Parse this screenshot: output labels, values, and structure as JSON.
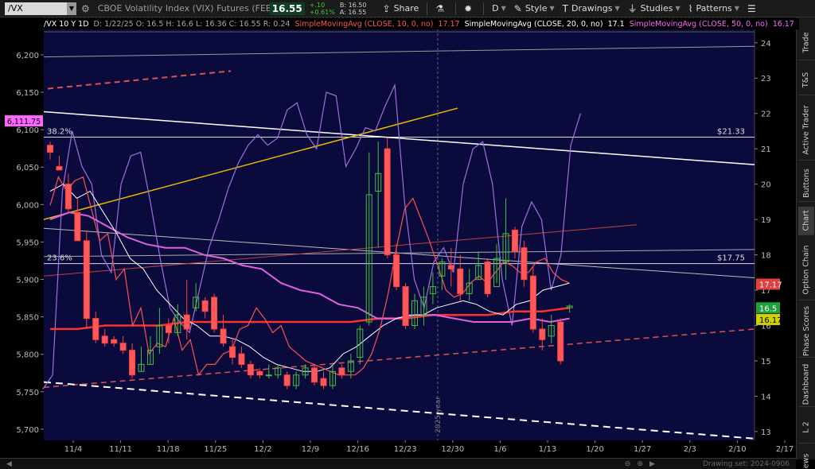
{
  "toolbar": {
    "symbol": "/VX",
    "description": "CBOE Volatility Index (VIX) Futures (FEB 25)",
    "last": "16.55",
    "change": "+.10",
    "change_pct": "+0.61%",
    "bid": "B: 16.50",
    "ask": "A: 16.55",
    "share": "Share",
    "period": "D",
    "style": "Style",
    "drawings": "Drawings",
    "studies": "Studies",
    "patterns": "Patterns"
  },
  "study_header": {
    "chart_label": "/VX 10 Y 1D",
    "ohlc": "D: 1/22/25  O: 16.5  H: 16.6  L: 16.36  C: 16.55  R: 0.24",
    "sma10": "SimpleMovingAvg (CLOSE, 10, 0, no)",
    "sma10_val": "17.17",
    "sma20": "SimpleMovingAvg (CLOSE, 20, 0, no)",
    "sma20_val": "17.1",
    "sma50": "SimpleMovingAvg (CLOSE, 50, 0, no)",
    "sma50_val": "16.17"
  },
  "chart_data": {
    "type": "candlestick",
    "left_axis": {
      "ticks": [
        "6,200",
        "6,150",
        "6,100",
        "6,050",
        "6,000",
        "5,950",
        "5,900",
        "5,850",
        "5,800",
        "5,750",
        "5,700"
      ],
      "values": [
        6200,
        6150,
        6100,
        6050,
        6000,
        5950,
        5900,
        5850,
        5800,
        5750,
        5700
      ],
      "range": [
        5685,
        6235
      ],
      "marker": "6,111.75",
      "marker_value": 6111.75
    },
    "right_axis": {
      "ticks": [
        "24",
        "23",
        "22",
        "21",
        "20",
        "19",
        "18",
        "17",
        "16",
        "15",
        "14",
        "13"
      ],
      "values": [
        24,
        23,
        22,
        21,
        20,
        19,
        18,
        17,
        16,
        15,
        14,
        13
      ],
      "range": [
        12.75,
        24.4
      ]
    },
    "x_axis": {
      "labels": [
        "11/4",
        "11/11",
        "11/18",
        "11/25",
        "12/2",
        "12/9",
        "12/16",
        "12/23",
        "12/30",
        "1/6",
        "1/13",
        "1/20",
        "1/27",
        "2/3",
        "2/10",
        "2/17"
      ]
    },
    "year_marker": "2025 year",
    "fib_levels": [
      {
        "label": "38.2%",
        "price": "$21.33",
        "value": 21.33
      },
      {
        "label": "23.6%",
        "price": "$17.75",
        "value": 17.75
      }
    ],
    "sma200": [
      [
        15.9,
        15.9
      ],
      [
        16.0,
        16.0
      ],
      [
        16.0,
        16.1
      ],
      [
        16.1,
        16.1
      ],
      [
        16.1,
        16.1
      ],
      [
        16.1,
        16.1
      ],
      [
        16.2,
        16.2
      ],
      [
        16.3,
        16.3
      ],
      [
        16.3,
        16.4
      ],
      [
        16.4,
        16.5
      ]
    ],
    "price_badges": [
      {
        "label": "17.17",
        "value": 17.17,
        "color": "#e04040"
      },
      {
        "label": "16.5",
        "value": 16.5,
        "color": "#20a040"
      },
      {
        "label": "16.17",
        "value": 16.17,
        "color": "#d0d000"
      }
    ],
    "candles": [
      [
        21.1,
        21.1,
        20.9,
        21.2,
        20.7
      ],
      [
        20.5,
        20.7,
        20.4,
        20.8,
        20.4
      ],
      [
        20.0,
        20.2,
        19.3,
        20.3,
        19.2
      ],
      [
        19.2,
        19.5,
        18.4,
        19.6,
        18.4
      ],
      [
        18.4,
        18.5,
        16.2,
        18.7,
        15.9
      ],
      [
        16.2,
        16.3,
        15.6,
        16.4,
        15.5
      ],
      [
        15.7,
        15.8,
        15.5,
        15.9,
        15.4
      ],
      [
        15.6,
        15.6,
        15.5,
        15.7,
        15.4
      ],
      [
        15.5,
        15.6,
        15.3,
        15.7,
        15.2
      ],
      [
        15.3,
        15.5,
        14.6,
        15.5,
        14.5
      ],
      [
        14.7,
        14.9,
        14.9,
        15.4,
        14.7
      ],
      [
        14.9,
        15.5,
        15.3,
        15.7,
        14.9
      ],
      [
        15.4,
        16.1,
        16.0,
        16.5,
        15.2
      ],
      [
        16.0,
        16.0,
        15.8,
        16.2,
        15.5
      ],
      [
        15.8,
        16.4,
        16.3,
        16.6,
        15.7
      ],
      [
        16.3,
        16.3,
        15.9,
        17.3,
        15.6
      ],
      [
        16.5,
        16.9,
        16.8,
        17.2,
        16.4
      ],
      [
        16.7,
        16.7,
        16.4,
        16.8,
        16.2
      ],
      [
        16.8,
        16.8,
        15.9,
        16.9,
        15.8
      ],
      [
        15.9,
        16.0,
        15.5,
        16.3,
        15.4
      ],
      [
        15.4,
        15.5,
        15.1,
        15.6,
        14.9
      ],
      [
        15.2,
        15.2,
        14.9,
        15.4,
        14.8
      ],
      [
        14.9,
        14.9,
        14.6,
        15.0,
        14.5
      ],
      [
        14.7,
        14.7,
        14.6,
        14.8,
        14.5
      ],
      [
        14.6,
        14.7,
        14.6,
        14.9,
        14.5
      ],
      [
        14.6,
        14.9,
        14.8,
        14.9,
        14.5
      ],
      [
        14.6,
        14.6,
        14.3,
        14.7,
        14.2
      ],
      [
        14.3,
        14.6,
        14.6,
        14.7,
        14.2
      ],
      [
        14.6,
        14.8,
        14.8,
        14.9,
        14.5
      ],
      [
        14.8,
        14.8,
        14.4,
        14.9,
        14.3
      ],
      [
        14.5,
        14.5,
        14.3,
        14.7,
        14.2
      ],
      [
        14.3,
        14.8,
        14.7,
        14.9,
        14.2
      ],
      [
        14.8,
        14.8,
        14.6,
        14.9,
        14.5
      ],
      [
        14.7,
        15.0,
        15.0,
        15.2,
        14.5
      ],
      [
        15.1,
        16.0,
        15.9,
        16.0,
        14.9
      ],
      [
        16.1,
        19.9,
        19.7,
        20.9,
        16.0
      ],
      [
        19.8,
        21.0,
        20.3,
        21.2,
        18.2
      ],
      [
        21.0,
        21.1,
        18.0,
        21.3,
        17.9
      ],
      [
        18.0,
        18.0,
        17.1,
        18.3,
        17.0
      ],
      [
        17.1,
        17.1,
        16.0,
        17.2,
        15.9
      ],
      [
        16.0,
        16.7,
        16.7,
        16.9,
        15.9
      ],
      [
        16.3,
        16.8,
        16.8,
        17.1,
        16.0
      ],
      [
        16.9,
        17.2,
        17.1,
        17.5,
        16.6
      ],
      [
        17.4,
        17.9,
        17.8,
        17.9,
        17.0
      ],
      [
        17.7,
        17.7,
        17.6,
        18.2,
        17.1
      ],
      [
        17.6,
        17.7,
        16.9,
        18.0,
        16.7
      ],
      [
        16.9,
        17.4,
        17.2,
        17.6,
        16.7
      ],
      [
        17.3,
        17.8,
        17.7,
        18.1,
        17.3
      ],
      [
        17.8,
        17.8,
        16.9,
        17.9,
        16.8
      ],
      [
        17.1,
        18.0,
        17.9,
        18.3,
        17.2
      ],
      [
        17.8,
        18.7,
        18.6,
        19.6,
        17.3
      ],
      [
        18.7,
        18.7,
        18.1,
        18.8,
        17.9
      ],
      [
        18.2,
        18.2,
        17.3,
        18.4,
        17.1
      ],
      [
        17.4,
        17.6,
        15.9,
        17.7,
        15.8
      ],
      [
        15.9,
        16.1,
        15.6,
        16.2,
        15.3
      ],
      [
        15.7,
        16.1,
        16.0,
        16.3,
        15.5
      ],
      [
        16.1,
        16.1,
        15.0,
        16.2,
        14.9
      ],
      [
        16.5,
        16.6,
        16.55,
        16.6,
        16.36
      ]
    ],
    "sma10": [
      [
        19.4,
        20.2
      ],
      [
        19.8,
        20.1
      ],
      [
        20.2,
        19.3
      ],
      [
        18.4,
        18.6
      ],
      [
        17.3,
        17.6
      ],
      [
        16.0,
        16.5
      ],
      [
        15.2,
        15.5
      ],
      [
        15.4,
        16.2
      ],
      [
        15.3,
        15.6
      ],
      [
        14.6,
        14.9
      ],
      [
        14.9,
        15.2
      ],
      [
        15.3,
        15.9
      ],
      [
        16.0,
        16.5
      ],
      [
        16.2,
        15.8
      ],
      [
        16.0,
        15.4
      ],
      [
        15.2,
        15.0
      ],
      [
        14.9,
        14.8
      ],
      [
        14.7,
        14.6
      ],
      [
        14.6,
        14.6
      ],
      [
        14.8,
        15.2
      ],
      [
        15.9,
        16.9
      ],
      [
        18.2,
        19.3
      ],
      [
        19.6,
        19.0
      ],
      [
        18.4,
        17.7
      ],
      [
        17.0,
        16.8
      ],
      [
        16.9,
        17.2
      ],
      [
        17.4,
        17.2
      ],
      [
        17.5,
        17.8
      ],
      [
        17.7,
        17.5
      ],
      [
        17.5,
        17.8
      ],
      [
        17.9,
        17.5
      ],
      [
        17.3,
        17.2
      ]
    ],
    "sma20": [
      [
        19.8,
        20.0
      ],
      [
        19.6,
        19.8
      ],
      [
        19.2,
        18.6
      ],
      [
        17.9,
        17.6
      ],
      [
        17.0,
        16.6
      ],
      [
        16.2,
        16.0
      ],
      [
        15.7,
        15.7
      ],
      [
        15.6,
        15.4
      ],
      [
        15.1,
        14.9
      ],
      [
        14.8,
        14.7
      ],
      [
        14.7,
        14.8
      ],
      [
        15.2,
        15.4
      ],
      [
        15.7,
        16.0
      ],
      [
        16.2,
        16.3
      ],
      [
        16.3,
        16.5
      ],
      [
        16.6,
        16.7
      ],
      [
        16.6,
        16.4
      ],
      [
        16.3,
        16.6
      ],
      [
        16.7,
        17.0
      ],
      [
        17.1,
        17.2
      ]
    ],
    "sma50": [
      [
        19.0,
        19.2
      ],
      [
        19.1,
        18.8
      ],
      [
        18.5,
        18.3
      ],
      [
        18.2,
        18.2
      ],
      [
        18.0,
        17.9
      ],
      [
        17.7,
        17.6
      ],
      [
        17.2,
        17.0
      ],
      [
        16.9,
        16.6
      ],
      [
        16.5,
        16.2
      ],
      [
        16.2,
        16.3
      ],
      [
        16.3,
        16.2
      ],
      [
        16.1,
        16.1
      ],
      [
        16.1,
        16.2
      ],
      [
        16.1,
        16.2
      ]
    ],
    "purple_line": [
      [
        14.2,
        14.6
      ],
      [
        19.8,
        21.5
      ],
      [
        20.5,
        20.0
      ],
      [
        18.0,
        17.5
      ],
      [
        20.0,
        20.8
      ],
      [
        20.9,
        19.5
      ],
      [
        17.9,
        16.5
      ],
      [
        16.1,
        15.8
      ],
      [
        17.0,
        18.2
      ],
      [
        19.0,
        19.9
      ],
      [
        20.6,
        21.1
      ],
      [
        21.4,
        21.1
      ],
      [
        21.3,
        22.1
      ],
      [
        22.3,
        21.4
      ],
      [
        21.0,
        22.6
      ],
      [
        22.5,
        20.5
      ],
      [
        21.0,
        21.6
      ],
      [
        21.5,
        22.2
      ],
      [
        22.8,
        19.5
      ],
      [
        17.3,
        16.5
      ],
      [
        17.8,
        18.2
      ],
      [
        17.5,
        20.0
      ],
      [
        21.0,
        21.2
      ],
      [
        20.0,
        17.3
      ],
      [
        16.0,
        18.8
      ],
      [
        19.5,
        19.0
      ],
      [
        17.0,
        18.0
      ],
      [
        21.1,
        22.0
      ]
    ]
  },
  "right_tabs": [
    "Trade",
    "T&S",
    "Active Trader",
    "Buttons",
    "Chart",
    "Option Chain",
    "Phase Scores",
    "Dashboard",
    "L 2",
    "News"
  ],
  "drawing_set": "Drawing set: 2024-0906"
}
